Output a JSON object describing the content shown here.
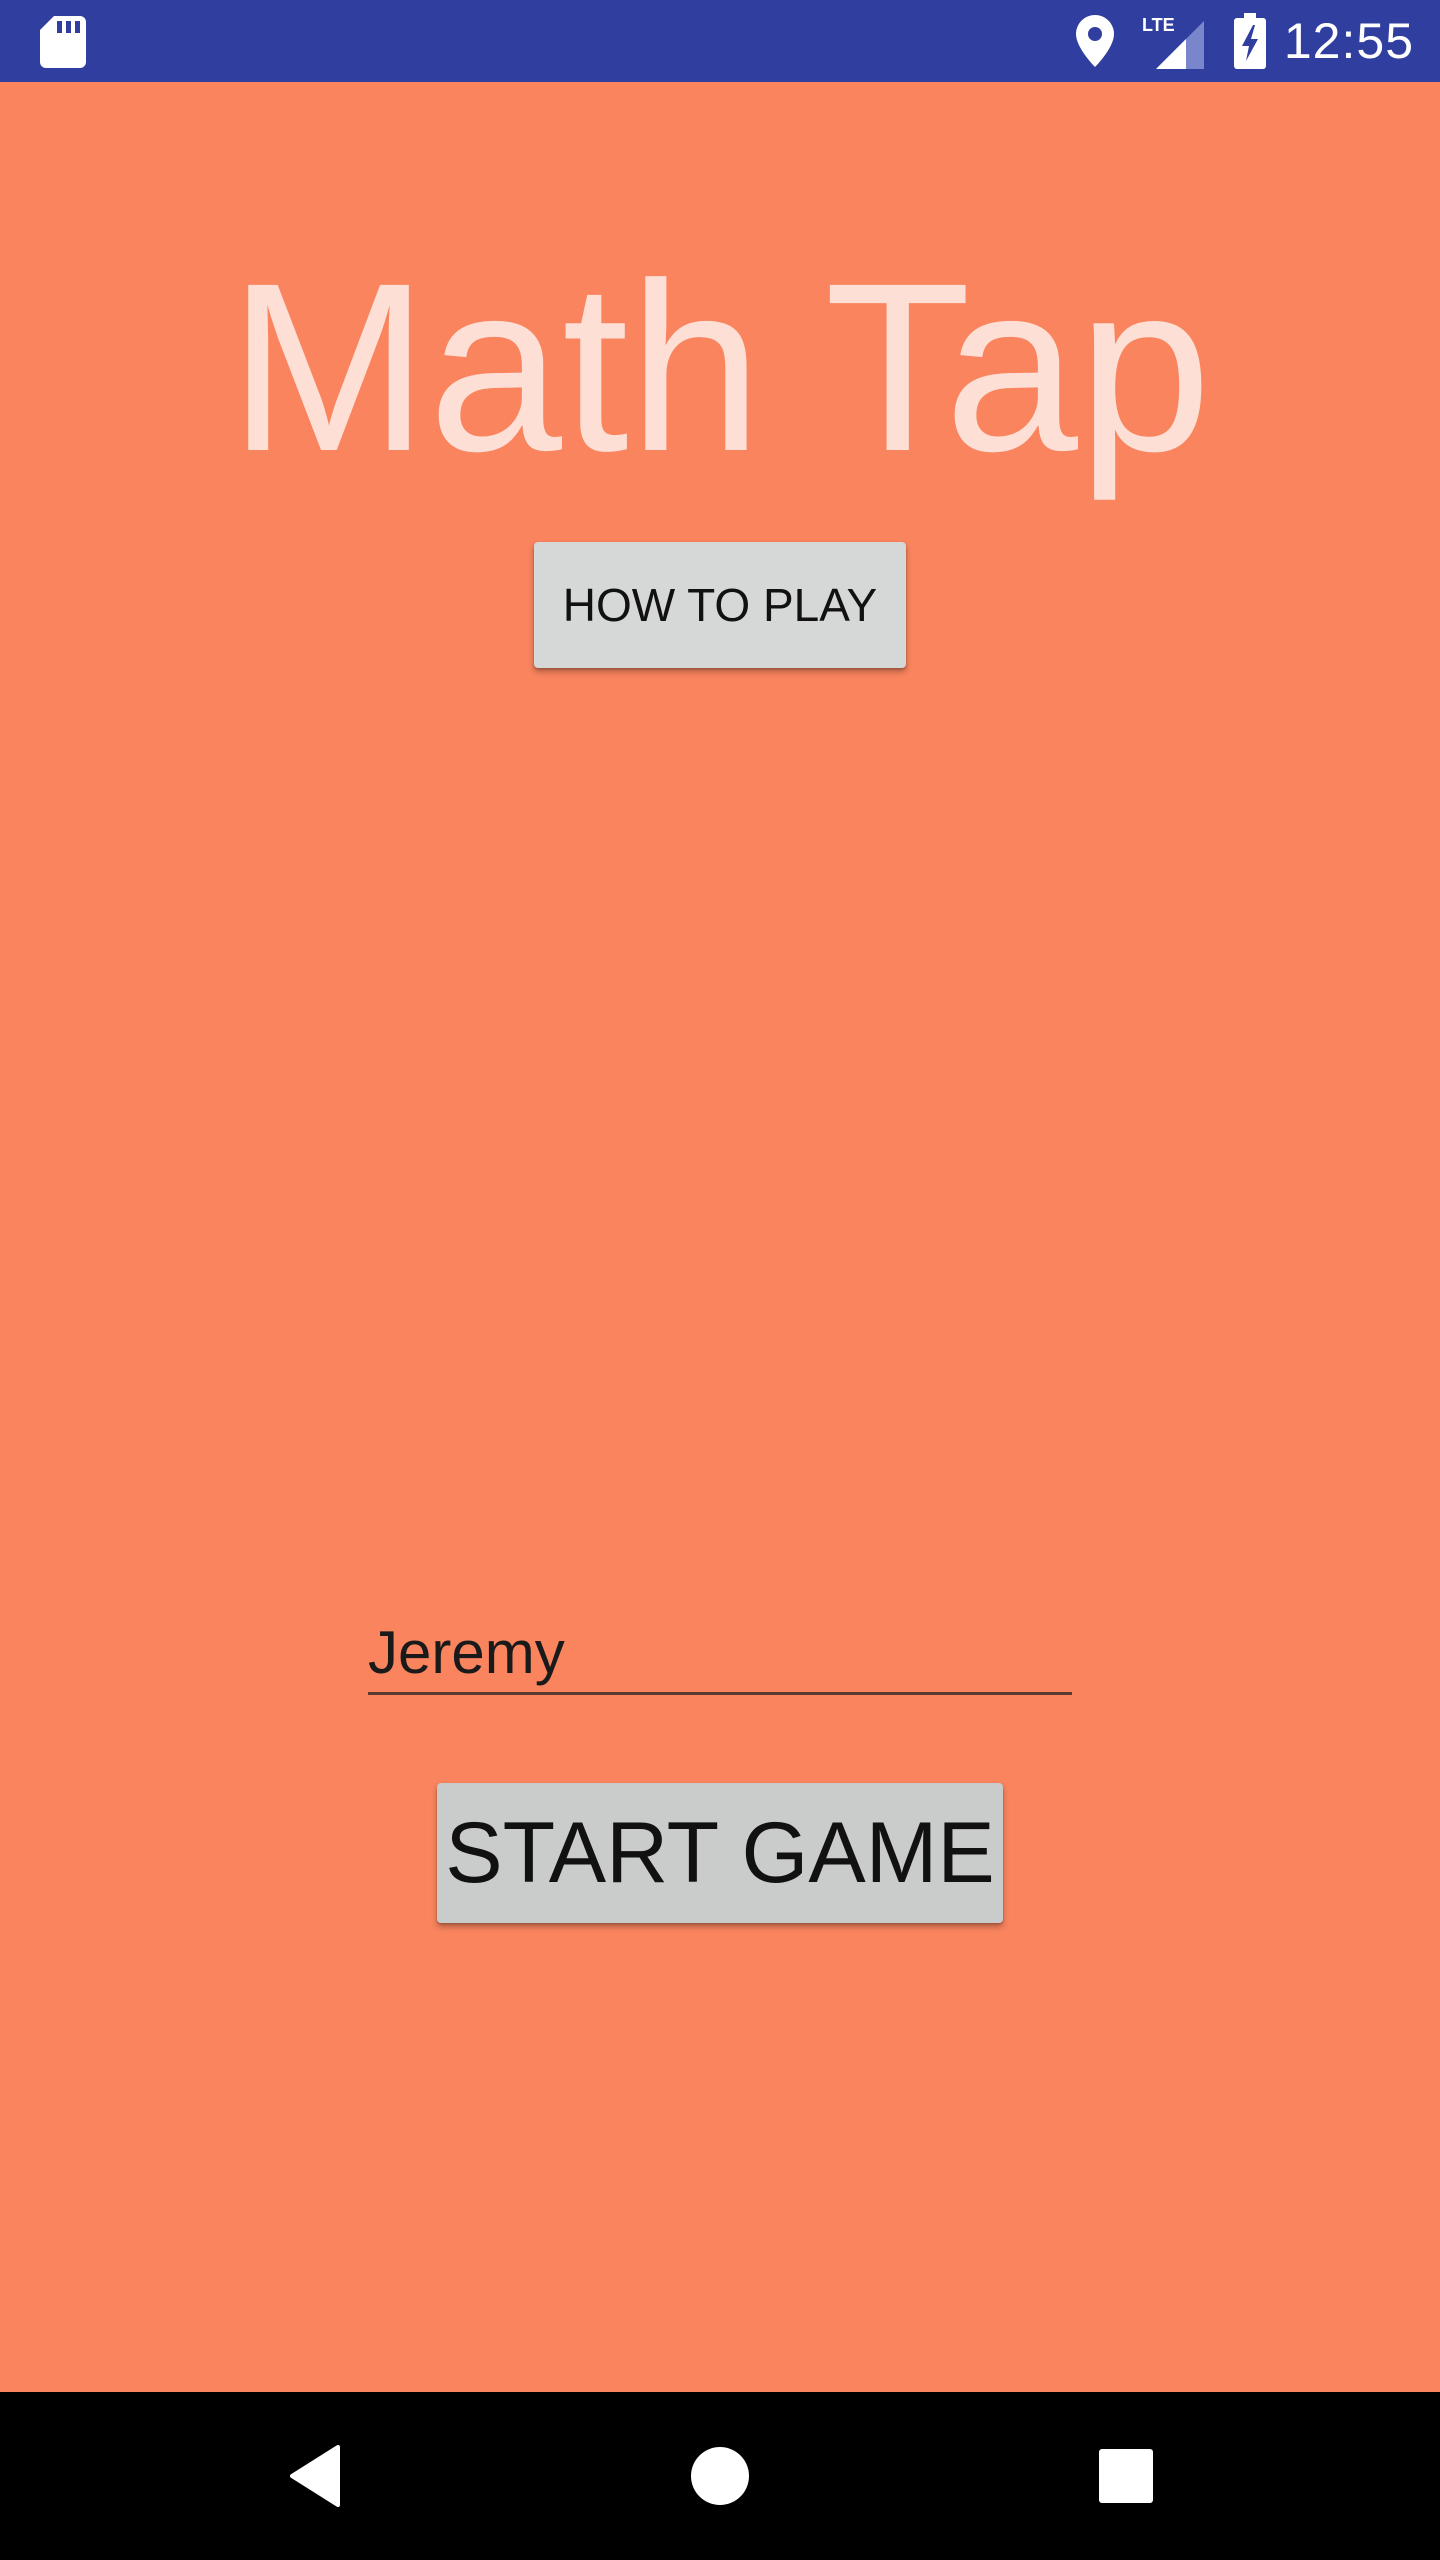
{
  "status_bar": {
    "time": "12:55",
    "network_label": "LTE",
    "icons": [
      "sd-card-icon",
      "location-icon",
      "signal-icon",
      "battery-charging-icon"
    ],
    "background_color": "#303F9F"
  },
  "app": {
    "title": "Math Tap",
    "how_to_play_label": "HOW TO PLAY",
    "player_name_value": "Jeremy",
    "start_game_label": "START GAME",
    "background_color": "#F9845E",
    "title_color": "#FDDFD6"
  },
  "nav_bar": {
    "icons": [
      "back-icon",
      "home-icon",
      "recents-icon"
    ]
  }
}
